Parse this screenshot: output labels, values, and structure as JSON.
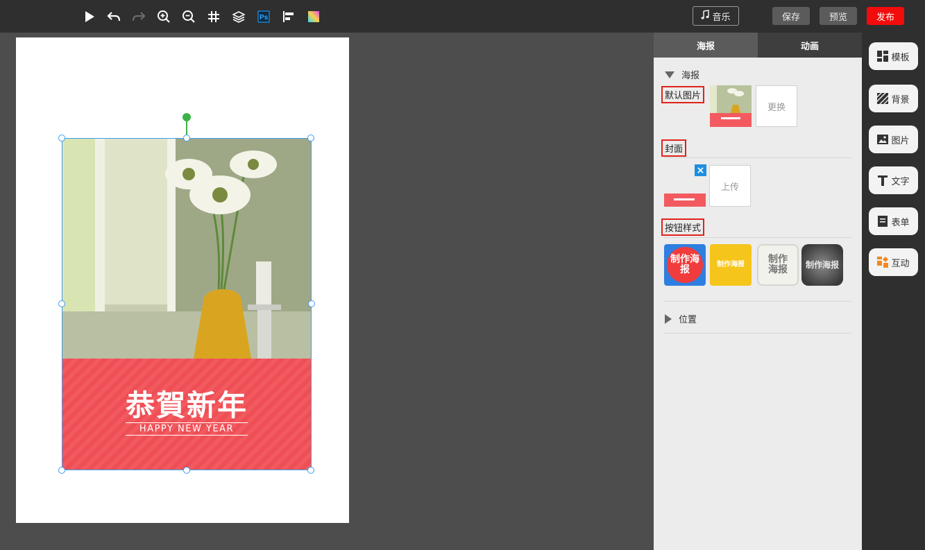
{
  "toolbar": {
    "icons": [
      "play-icon",
      "undo-icon",
      "redo-icon",
      "zoom-in-icon",
      "zoom-out-icon",
      "grid-icon",
      "layers-icon",
      "photoshop-icon",
      "align-left-icon",
      "color-gradient-icon"
    ],
    "music_label": "音乐",
    "save_label": "保存",
    "preview_label": "预览",
    "publish_label": "发布",
    "publish_color": "#f20c0c"
  },
  "canvas": {
    "poster_title": "恭賀新年",
    "poster_subtitle": "HAPPY NEW YEAR",
    "selection_color": "#3b9cf2",
    "rotate_color": "#3bb346"
  },
  "panel": {
    "tabs": [
      {
        "label": "海报",
        "active": true
      },
      {
        "label": "动画",
        "active": false
      }
    ],
    "section_poster": "海报",
    "default_image_label": "默认图片",
    "replace_label": "更换",
    "cover_label": "封面",
    "upload_label": "上传",
    "button_style_label": "按钮样式",
    "button_styles": [
      "制作海报",
      "制作海报",
      "制作海报",
      "制作海报"
    ],
    "position_label": "位置",
    "highlight_color": "#e0211a"
  },
  "rail": {
    "items": [
      {
        "label": "模板",
        "icon": "template-icon"
      },
      {
        "label": "背景",
        "icon": "background-icon"
      },
      {
        "label": "图片",
        "icon": "image-icon"
      },
      {
        "label": "文字",
        "icon": "text-icon"
      },
      {
        "label": "表单",
        "icon": "form-icon"
      },
      {
        "label": "互动",
        "icon": "interaction-icon"
      }
    ]
  }
}
